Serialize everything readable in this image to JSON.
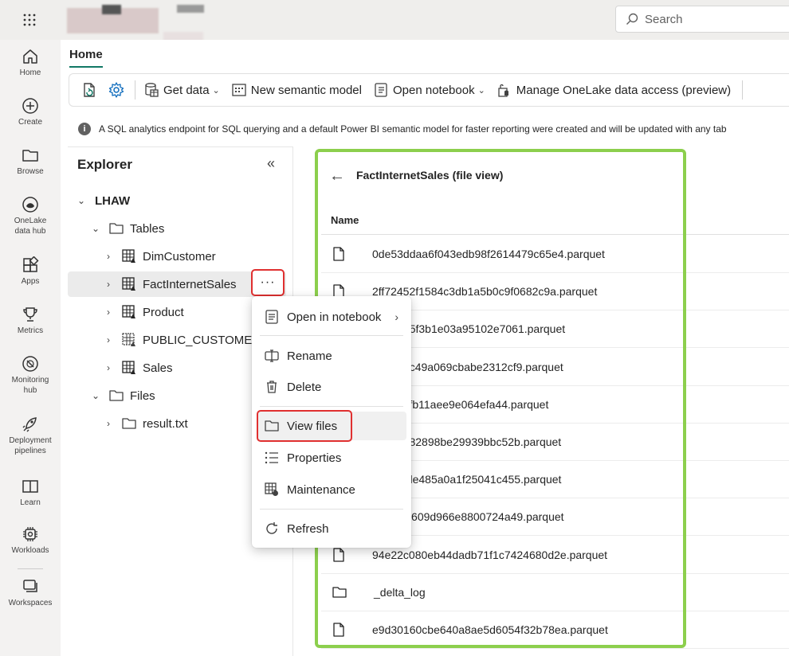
{
  "topbar": {
    "search_placeholder": "Search"
  },
  "rail": [
    {
      "label": "Home",
      "icon": "home-icon"
    },
    {
      "label": "Create",
      "icon": "plus-circle-icon"
    },
    {
      "label": "Browse",
      "icon": "folder-icon"
    },
    {
      "label": "OneLake data hub",
      "icon": "onelake-icon"
    },
    {
      "label": "Apps",
      "icon": "apps-icon"
    },
    {
      "label": "Metrics",
      "icon": "trophy-icon"
    },
    {
      "label": "Monitoring hub",
      "icon": "monitor-icon"
    },
    {
      "label": "Deployment pipelines",
      "icon": "rocket-icon"
    },
    {
      "label": "Learn",
      "icon": "book-icon"
    },
    {
      "label": "Workloads",
      "icon": "chip-icon"
    },
    {
      "label": "Workspaces",
      "icon": "workspaces-icon"
    }
  ],
  "home_tab": "Home",
  "ribbon": {
    "get_data": "Get data",
    "new_semantic_model": "New semantic model",
    "open_notebook": "Open notebook",
    "manage_onelake": "Manage OneLake data access (preview)"
  },
  "info_text": "A SQL analytics endpoint for SQL querying and a default Power BI semantic model for faster reporting were created and will be updated with any tab",
  "explorer": {
    "title": "Explorer",
    "root": "LHAW",
    "tables_label": "Tables",
    "tables": [
      "DimCustomer",
      "FactInternetSales",
      "Product",
      "PUBLIC_CUSTOMER",
      "Sales"
    ],
    "files_label": "Files",
    "files": [
      "result.txt"
    ]
  },
  "context_menu": {
    "open_in_notebook": "Open in notebook",
    "rename": "Rename",
    "delete": "Delete",
    "view_files": "View files",
    "properties": "Properties",
    "maintenance": "Maintenance",
    "refresh": "Refresh"
  },
  "file_view": {
    "title": "FactInternetSales (file view)",
    "column_name": "Name",
    "rows": [
      {
        "name": "0de53ddaa6f043edb98f2614479c65e4.parquet",
        "type": "file"
      },
      {
        "name": "2ff72452f1584c3db1a5b0c9f0682c9a.parquet",
        "type": "file"
      },
      {
        "name": "d49ba45f3b1e03a95102e7061.parquet",
        "type": "file"
      },
      {
        "name": "421574c49a069cbabe2312cf9.parquet",
        "type": "file"
      },
      {
        "name": ":2eff4fefb11aee9e064efa44.parquet",
        "type": "file"
      },
      {
        "name": "39dff4482898be29939bbc52b.parquet",
        "type": "file"
      },
      {
        "name": "d17f44de485a0a1f25041c455.parquet",
        "type": "file"
      },
      {
        "name": "c8bfc43609d966e8800724a49.parquet",
        "type": "file"
      },
      {
        "name": "94e22c080eb44dadb71f1c7424680d2e.parquet",
        "type": "file"
      },
      {
        "name": "_delta_log",
        "type": "folder"
      },
      {
        "name": "e9d30160cbe640a8ae5d6054f32b78ea.parquet",
        "type": "file"
      }
    ]
  },
  "colors": {
    "accent": "#117865",
    "highlight_red": "#e03030",
    "highlight_green": "#8ccf4d"
  }
}
